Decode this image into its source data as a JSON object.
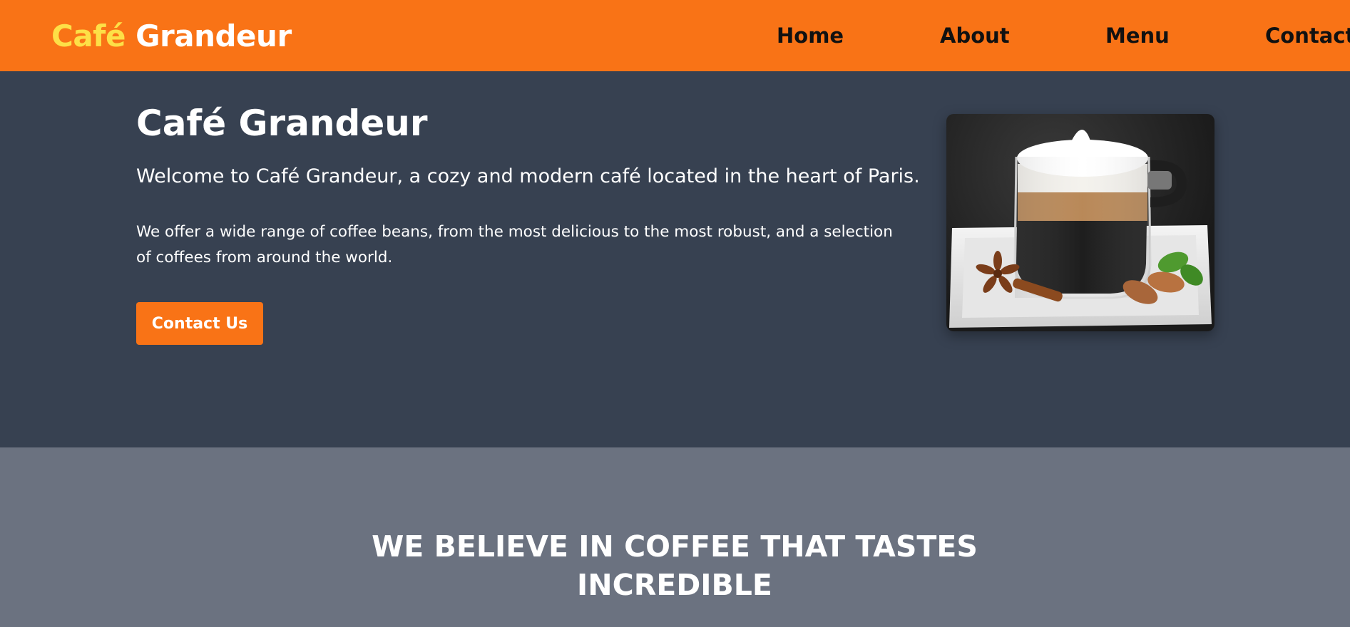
{
  "nav": {
    "brand_accent": "Café",
    "brand_main": "Grandeur",
    "links": [
      "Home",
      "About",
      "Menu",
      "Contact"
    ]
  },
  "hero": {
    "title": "Café Grandeur",
    "lead": "Welcome to Café Grandeur, a cozy and modern café located in the heart of Paris.",
    "description": "We offer a wide range of coffee beans, from the most delicious to the most robust, and a selection of coffees from around the world.",
    "cta_label": "Contact Us",
    "image_subject": "glass cup of layered latte on white saucer with star anise, cinnamon and almonds"
  },
  "belief": {
    "heading": "WE BELIEVE IN COFFEE THAT TASTES INCREDIBLE"
  },
  "colors": {
    "accent_orange": "#f97316",
    "brand_yellow": "#fde047",
    "hero_bg": "#374151",
    "section_bg": "#6b7280",
    "text_white": "#ffffff",
    "nav_text": "#111111"
  }
}
